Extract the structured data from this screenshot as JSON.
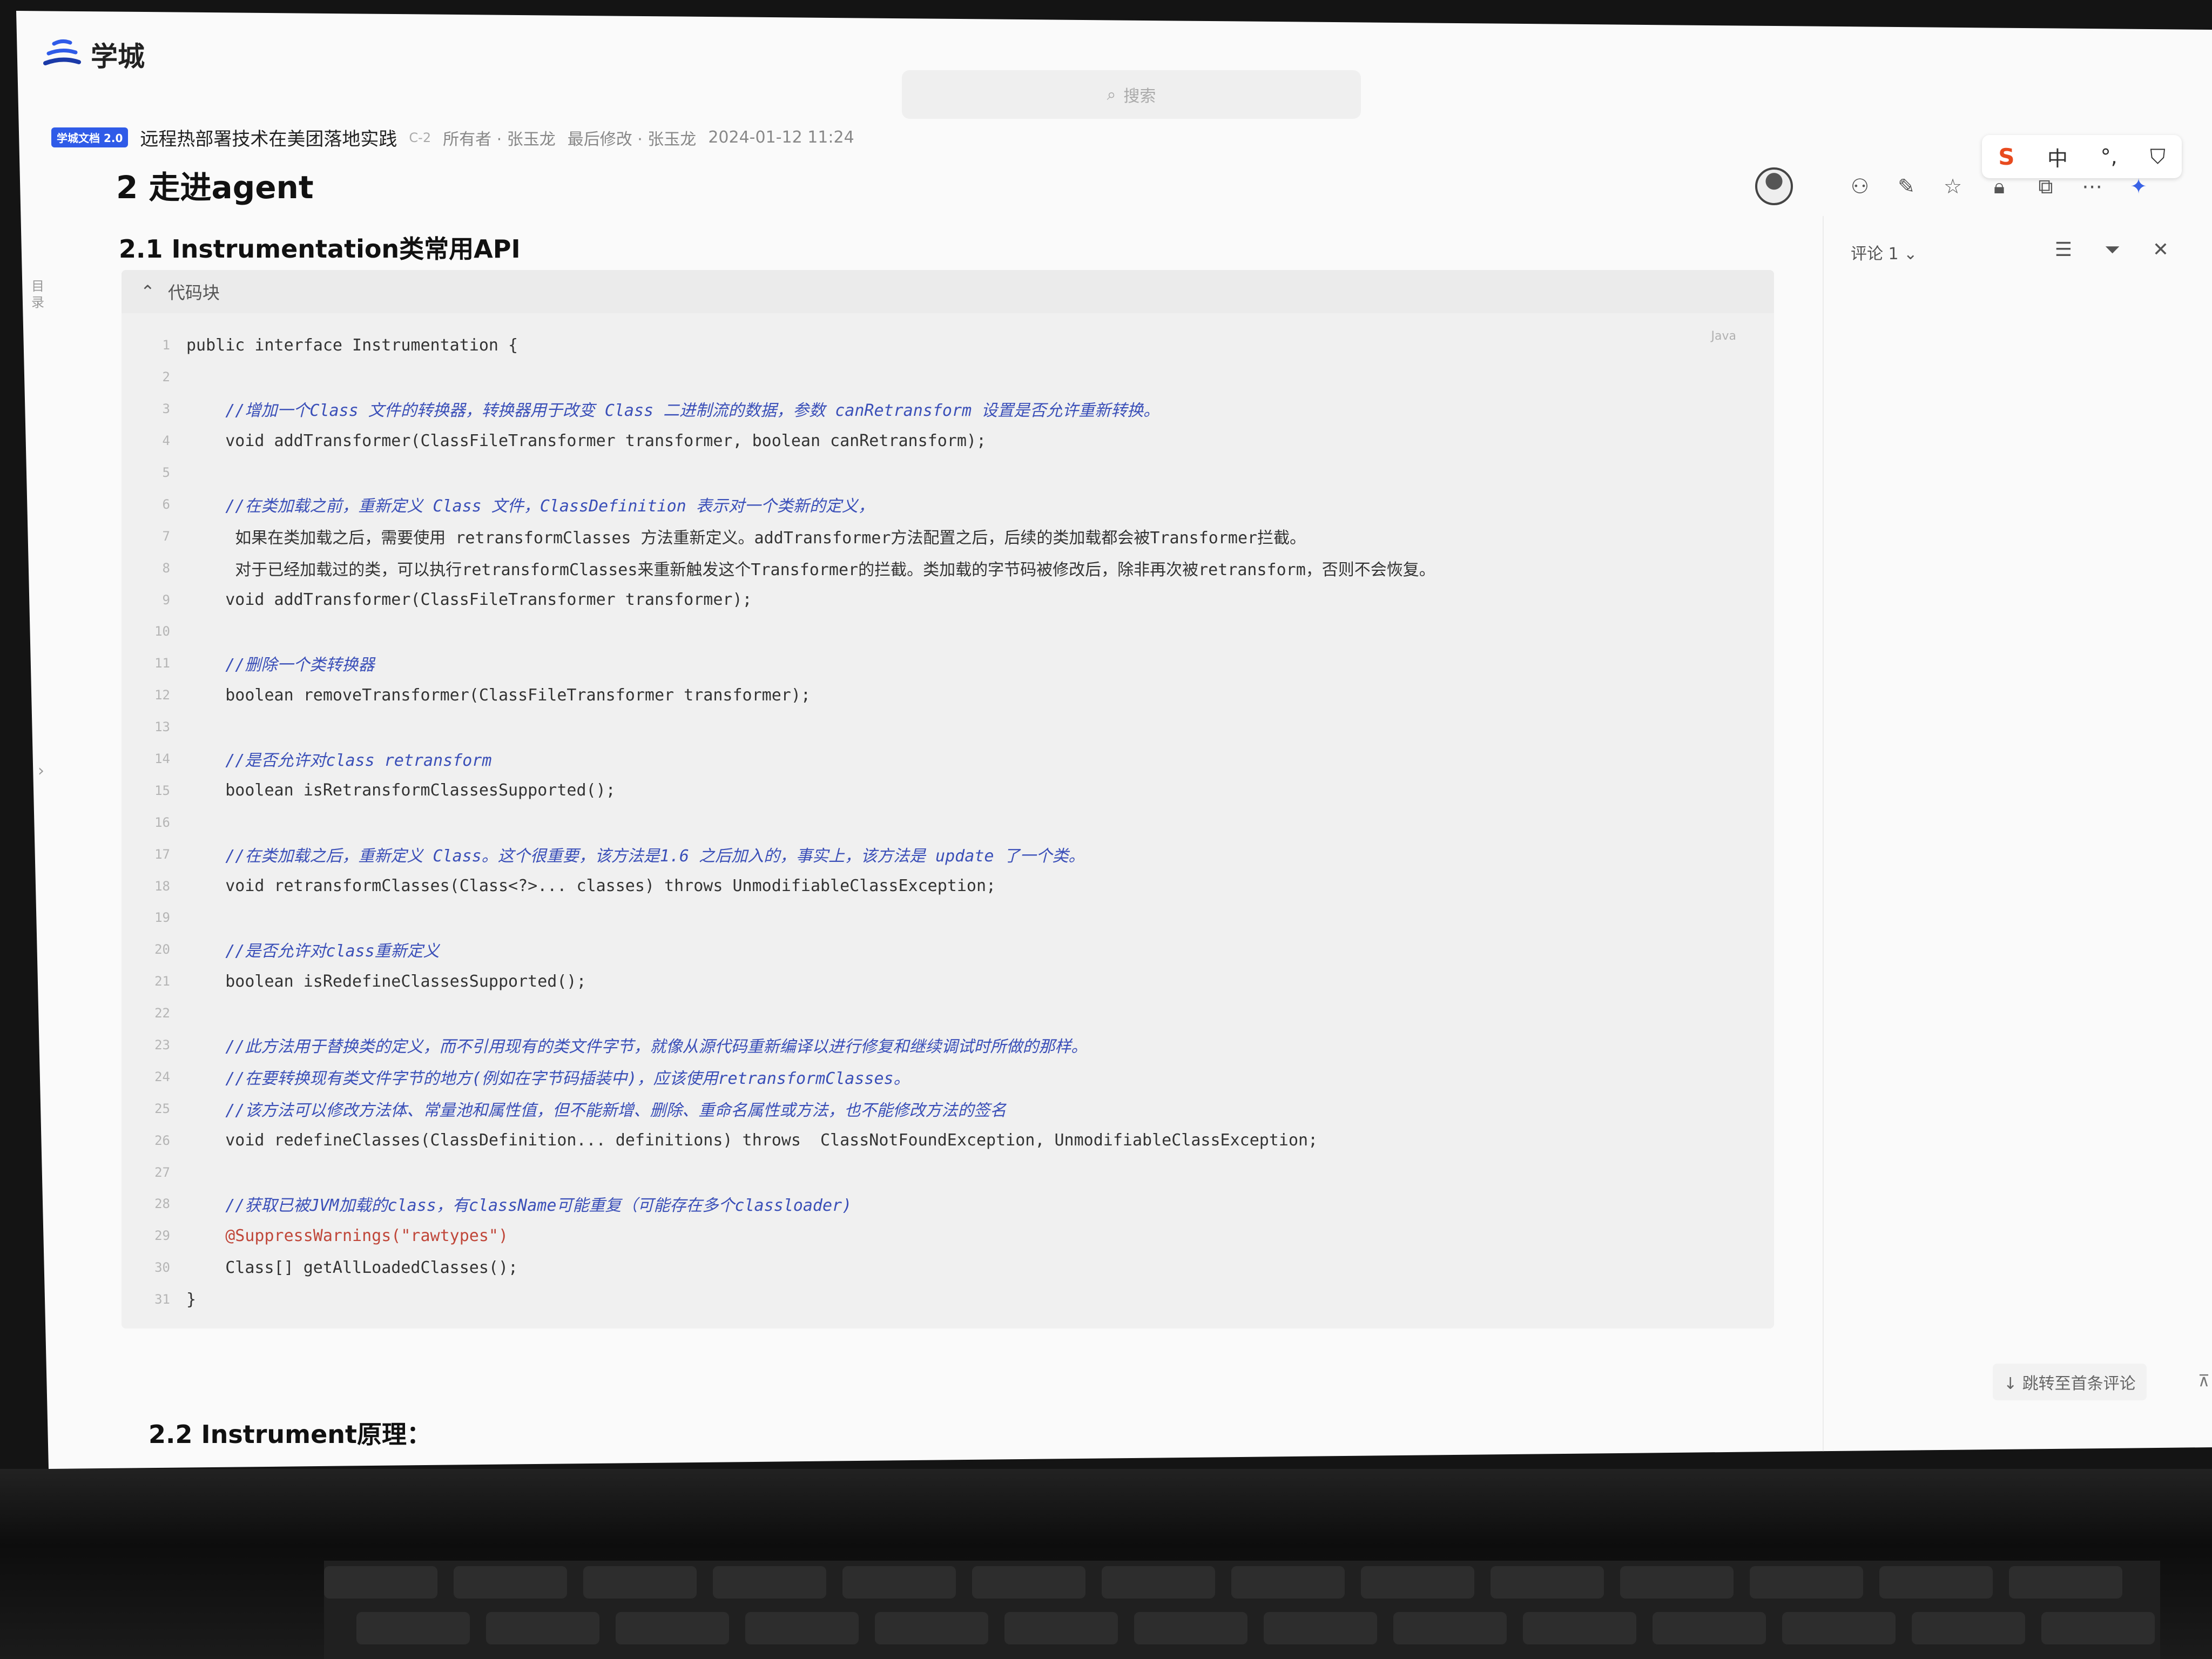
{
  "app": {
    "logo_text": "学城"
  },
  "search": {
    "placeholder": "搜索"
  },
  "doc": {
    "badge": "学城文档 2.0",
    "title": "远程热部署技术在美团落地实践",
    "version": "C-2",
    "owner": "所有者 · 张玉龙",
    "last_modified": "最后修改 · 张玉龙",
    "timestamp": "2024-01-12 11:24"
  },
  "headings": {
    "h2": "2 走进agent",
    "h2_1": "2.1 Instrumentation类常用API",
    "h2_2": "2.2 Instrument原理："
  },
  "toc_tab": "目录",
  "code_block": {
    "header": "代码块",
    "language": "Java",
    "lines": [
      {
        "n": "1",
        "kind": "code",
        "text": "public interface Instrumentation {"
      },
      {
        "n": "2",
        "kind": "code",
        "text": ""
      },
      {
        "n": "3",
        "kind": "comment",
        "text": "    //增加一个Class 文件的转换器，转换器用于改变 Class 二进制流的数据，参数 canRetransform 设置是否允许重新转换。"
      },
      {
        "n": "4",
        "kind": "code",
        "text": "    void addTransformer(ClassFileTransformer transformer, boolean canRetransform);"
      },
      {
        "n": "5",
        "kind": "code",
        "text": ""
      },
      {
        "n": "6",
        "kind": "comment",
        "text": "    //在类加载之前，重新定义 Class 文件，ClassDefinition 表示对一个类新的定义，"
      },
      {
        "n": "7",
        "kind": "note",
        "text": "     如果在类加载之后，需要使用 retransformClasses 方法重新定义。addTransformer方法配置之后，后续的类加载都会被Transformer拦截。"
      },
      {
        "n": "8",
        "kind": "note",
        "text": "     对于已经加载过的类，可以执行retransformClasses来重新触发这个Transformer的拦截。类加载的字节码被修改后，除非再次被retransform，否则不会恢复。"
      },
      {
        "n": "9",
        "kind": "code",
        "text": "    void addTransformer(ClassFileTransformer transformer);"
      },
      {
        "n": "10",
        "kind": "code",
        "text": ""
      },
      {
        "n": "11",
        "kind": "comment",
        "text": "    //删除一个类转换器"
      },
      {
        "n": "12",
        "kind": "code",
        "text": "    boolean removeTransformer(ClassFileTransformer transformer);"
      },
      {
        "n": "13",
        "kind": "code",
        "text": ""
      },
      {
        "n": "14",
        "kind": "comment",
        "text": "    //是否允许对class retransform"
      },
      {
        "n": "15",
        "kind": "code",
        "text": "    boolean isRetransformClassesSupported();"
      },
      {
        "n": "16",
        "kind": "code",
        "text": ""
      },
      {
        "n": "17",
        "kind": "comment",
        "text": "    //在类加载之后，重新定义 Class。这个很重要，该方法是1.6 之后加入的，事实上，该方法是 update 了一个类。"
      },
      {
        "n": "18",
        "kind": "code",
        "text": "    void retransformClasses(Class<?>... classes) throws UnmodifiableClassException;"
      },
      {
        "n": "19",
        "kind": "code",
        "text": ""
      },
      {
        "n": "20",
        "kind": "comment",
        "text": "    //是否允许对class重新定义"
      },
      {
        "n": "21",
        "kind": "code",
        "text": "    boolean isRedefineClassesSupported();"
      },
      {
        "n": "22",
        "kind": "code",
        "text": ""
      },
      {
        "n": "23",
        "kind": "comment",
        "text": "    //此方法用于替换类的定义，而不引用现有的类文件字节，就像从源代码重新编译以进行修复和继续调试时所做的那样。"
      },
      {
        "n": "24",
        "kind": "comment",
        "text": "    //在要转换现有类文件字节的地方(例如在字节码插装中)，应该使用retransformClasses。"
      },
      {
        "n": "25",
        "kind": "comment",
        "text": "    //该方法可以修改方法体、常量池和属性值，但不能新增、删除、重命名属性或方法，也不能修改方法的签名"
      },
      {
        "n": "26",
        "kind": "code",
        "text": "    void redefineClasses(ClassDefinition... definitions) throws  ClassNotFoundException, UnmodifiableClassException;"
      },
      {
        "n": "27",
        "kind": "code",
        "text": ""
      },
      {
        "n": "28",
        "kind": "comment",
        "text": "    //获取已被JVM加载的class，有className可能重复（可能存在多个classloader)"
      },
      {
        "n": "29",
        "kind": "ann",
        "text": "    @SuppressWarnings(\"rawtypes\")"
      },
      {
        "n": "30",
        "kind": "code",
        "text": "    Class[] getAllLoadedClasses();"
      },
      {
        "n": "31",
        "kind": "code",
        "text": "}"
      }
    ]
  },
  "ime": {
    "logo": "S",
    "lang": "中",
    "punct": "°,",
    "skin": "⛉"
  },
  "comments": {
    "header": "评论 1 ⌄",
    "jump_first": "↓ 跳转至首条评论",
    "to_top": "⊼"
  },
  "icons": [
    "avatar",
    "share-icon",
    "pin-icon",
    "star-icon",
    "lock-icon",
    "external-icon",
    "more-icon",
    "ai-sparkle-icon"
  ]
}
